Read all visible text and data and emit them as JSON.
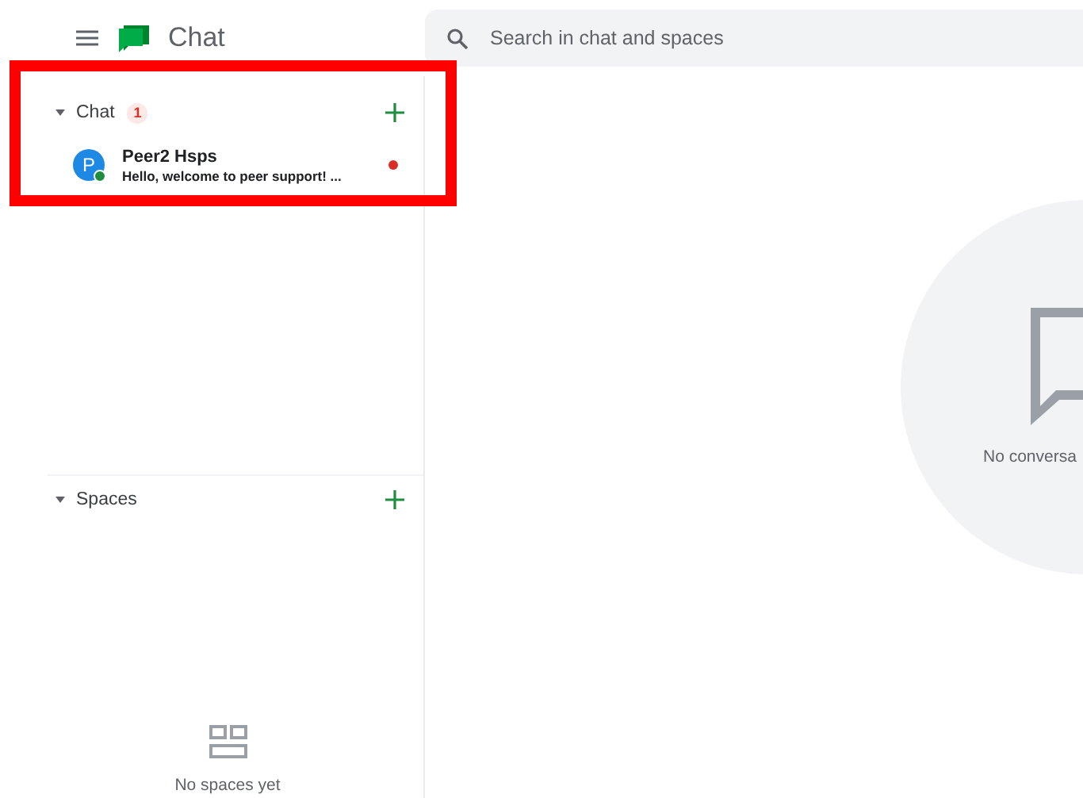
{
  "header": {
    "app_name": "Chat",
    "search": {
      "placeholder": "Search in chat and spaces"
    }
  },
  "chat_section": {
    "title": "Chat",
    "expanded": true,
    "badge": "1",
    "items": [
      {
        "initial": "P",
        "name": "Peer2 Hsps",
        "preview": "Hello, welcome to peer support! ...",
        "online": true,
        "unread": true
      }
    ]
  },
  "spaces_section": {
    "title": "Spaces",
    "expanded": true,
    "empty_text": "No spaces yet"
  },
  "main": {
    "empty_text": "No conversa"
  },
  "highlight": {
    "shown": true
  }
}
